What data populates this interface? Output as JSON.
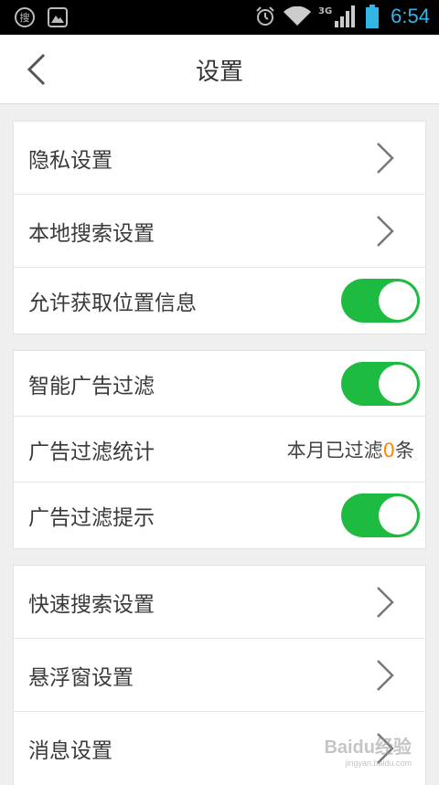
{
  "status_bar": {
    "time": "6:54",
    "network": "3G",
    "left_icons": [
      "sogou-search-icon",
      "image-icon"
    ],
    "right_icons": [
      "alarm-icon",
      "wifi-icon",
      "signal-icon",
      "battery-icon"
    ],
    "left_icon_glyph": "搜"
  },
  "header": {
    "title": "设置",
    "back_icon": "chevron-left-icon"
  },
  "groups": [
    {
      "rows": [
        {
          "label": "隐私设置",
          "type": "link"
        },
        {
          "label": "本地搜索设置",
          "type": "link"
        },
        {
          "label": "允许获取位置信息",
          "type": "toggle",
          "on": true
        }
      ]
    },
    {
      "rows": [
        {
          "label": "智能广告过滤",
          "type": "toggle",
          "on": true
        },
        {
          "label": "广告过滤统计",
          "type": "stat",
          "stat_prefix": "本月已过滤",
          "stat_value": "0",
          "stat_suffix": "条"
        },
        {
          "label": "广告过滤提示",
          "type": "toggle",
          "on": true
        }
      ]
    },
    {
      "rows": [
        {
          "label": "快速搜索设置",
          "type": "link"
        },
        {
          "label": "悬浮窗设置",
          "type": "link"
        },
        {
          "label": "消息设置",
          "type": "link"
        }
      ]
    }
  ],
  "watermark": {
    "text": "Baidu经验",
    "sub": "jingyan.baidu.com"
  },
  "colors": {
    "toggle_on": "#1dbc41",
    "accent_number": "#ff8a00",
    "status_time": "#33b5e5"
  }
}
